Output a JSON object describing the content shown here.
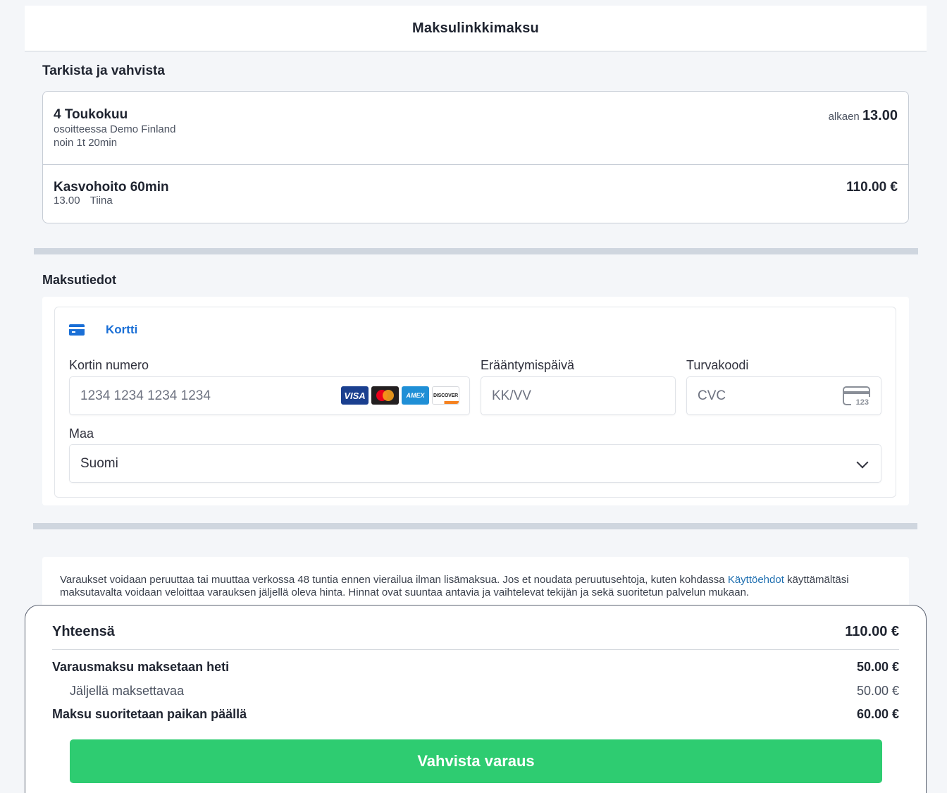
{
  "header": {
    "title": "Maksulinkkimaksu"
  },
  "review": {
    "title": "Tarkista ja vahvista",
    "date": "4 Toukokuu",
    "location": "osoitteessa Demo Finland",
    "duration": "noin 1t 20min",
    "from_label": "alkaen",
    "from_time": "13.00",
    "service": {
      "name": "Kasvohoito 60min",
      "time": "13.00",
      "staff": "Tiina",
      "price": "110.00 €"
    }
  },
  "payment": {
    "title": "Maksutiedot",
    "method_label": "Kortti",
    "card_number": {
      "label": "Kortin numero",
      "placeholder": "1234 1234 1234 1234"
    },
    "brands": {
      "visa": "VISA",
      "amex": "AMEX",
      "discover": "DISCOVER"
    },
    "expiry": {
      "label": "Erääntymispäivä",
      "placeholder": "KK/VV"
    },
    "cvc": {
      "label": "Turvakoodi",
      "placeholder": "CVC",
      "icon_text": "123"
    },
    "country": {
      "label": "Maa",
      "value": "Suomi"
    }
  },
  "terms": {
    "text": "Varaukset voidaan peruuttaa tai muuttaa verkossa 48 tuntia ennen vierailua ilman lisämaksua. Jos et noudata peruutusehtoja, kuten kohdassa ",
    "link": "Käyttöehdot",
    "text2": " käyttämältäsi maksutavalta voidaan veloittaa varauksen jäljellä oleva hinta. Hinnat ovat suuntaa antavia ja vaihtelevat tekijän ja sekä suoritetun palvelun mukaan."
  },
  "totals": {
    "total_label": "Yhteensä",
    "total_value": "110.00 €",
    "deposit_label": "Varausmaksu maksetaan heti",
    "deposit_value": "50.00 €",
    "remaining_label": "Jäljellä maksettavaa",
    "remaining_value": "50.00 €",
    "onsite_label": "Maksu suoritetaan paikan päällä",
    "onsite_value": "60.00 €",
    "confirm_label": "Vahvista varaus"
  },
  "colors": {
    "accent": "#1a6fd6",
    "confirm": "#2ecc71",
    "link": "#1f6fb0"
  }
}
